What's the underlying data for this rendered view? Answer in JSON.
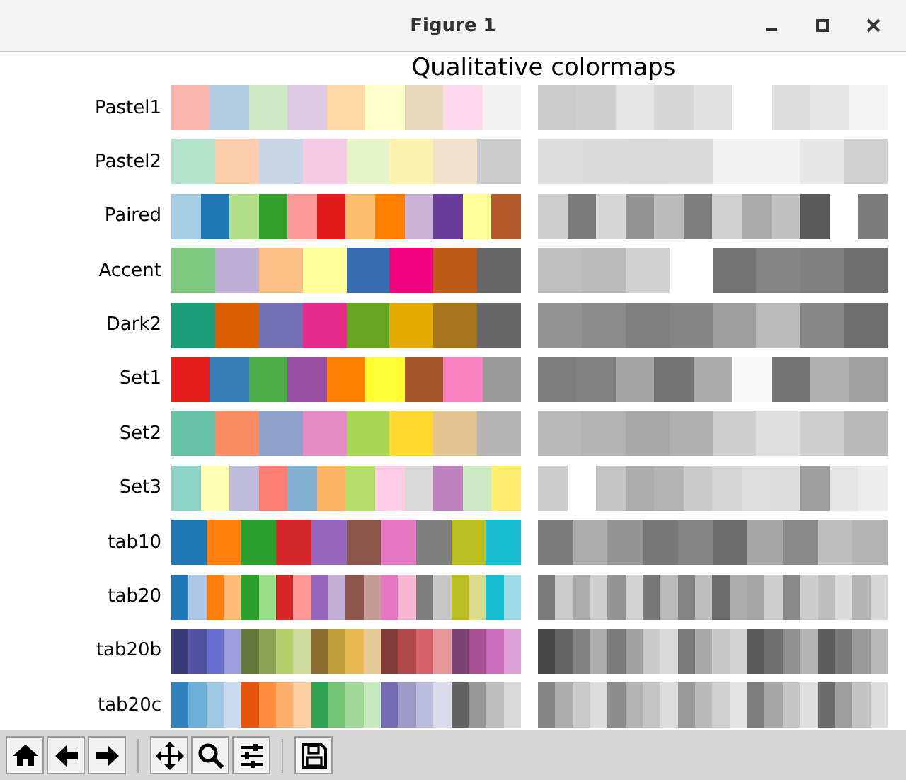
{
  "window": {
    "title": "Figure 1"
  },
  "figure": {
    "title": "Qualitative colormaps"
  },
  "colormaps": [
    {
      "name": "Pastel1",
      "colors": [
        {
          "color": "#fbb4ae"
        },
        {
          "color": "#b3cde3"
        },
        {
          "color": "#ccebc5"
        },
        {
          "color": "#decbe4"
        },
        {
          "color": "#fed9a6"
        },
        {
          "color": "#ffffcc"
        },
        {
          "color": "#e5d8bd"
        },
        {
          "color": "#fddaec"
        },
        {
          "color": "#f2f2f2"
        }
      ]
    },
    {
      "name": "Pastel2",
      "colors": [
        {
          "color": "#b3e2cd"
        },
        {
          "color": "#fdcdac"
        },
        {
          "color": "#cbd5e8"
        },
        {
          "color": "#f4cae4"
        },
        {
          "color": "#e6f5c9"
        },
        {
          "color": "#fff2ae"
        },
        {
          "color": "#f1e2cc"
        },
        {
          "color": "#cccccc"
        }
      ]
    },
    {
      "name": "Paired",
      "colors": [
        {
          "color": "#a6cee3"
        },
        {
          "color": "#1f78b4"
        },
        {
          "color": "#b2df8a"
        },
        {
          "color": "#33a02c"
        },
        {
          "color": "#fb9a99"
        },
        {
          "color": "#e31a1c"
        },
        {
          "color": "#fdbf6f"
        },
        {
          "color": "#ff7f00"
        },
        {
          "color": "#cab2d6"
        },
        {
          "color": "#6a3d9a"
        },
        {
          "color": "#ffff99"
        },
        {
          "color": "#b15928"
        }
      ]
    },
    {
      "name": "Accent",
      "colors": [
        {
          "color": "#7fc97f"
        },
        {
          "color": "#beaed4"
        },
        {
          "color": "#fdc086"
        },
        {
          "color": "#ffff99"
        },
        {
          "color": "#386cb0"
        },
        {
          "color": "#f0027f"
        },
        {
          "color": "#bf5b17"
        },
        {
          "color": "#666666"
        }
      ]
    },
    {
      "name": "Dark2",
      "colors": [
        {
          "color": "#1b9e77"
        },
        {
          "color": "#d95f02"
        },
        {
          "color": "#7570b3"
        },
        {
          "color": "#e7298a"
        },
        {
          "color": "#66a61e"
        },
        {
          "color": "#e6ab02"
        },
        {
          "color": "#a6761d"
        },
        {
          "color": "#666666"
        }
      ]
    },
    {
      "name": "Set1",
      "colors": [
        {
          "color": "#e41a1c"
        },
        {
          "color": "#377eb8"
        },
        {
          "color": "#4daf4a"
        },
        {
          "color": "#984ea3"
        },
        {
          "color": "#ff7f00"
        },
        {
          "color": "#ffff33"
        },
        {
          "color": "#a65628"
        },
        {
          "color": "#f781bf"
        },
        {
          "color": "#999999"
        }
      ]
    },
    {
      "name": "Set2",
      "colors": [
        {
          "color": "#66c2a5"
        },
        {
          "color": "#fc8d62"
        },
        {
          "color": "#8da0cb"
        },
        {
          "color": "#e78ac3"
        },
        {
          "color": "#a6d854"
        },
        {
          "color": "#ffd92f"
        },
        {
          "color": "#e5c494"
        },
        {
          "color": "#b3b3b3"
        }
      ]
    },
    {
      "name": "Set3",
      "colors": [
        {
          "color": "#8dd3c7"
        },
        {
          "color": "#ffffb3"
        },
        {
          "color": "#bebada"
        },
        {
          "color": "#fb8072"
        },
        {
          "color": "#80b1d3"
        },
        {
          "color": "#fdb462"
        },
        {
          "color": "#b3de69"
        },
        {
          "color": "#fccde5"
        },
        {
          "color": "#d9d9d9"
        },
        {
          "color": "#bc80bd"
        },
        {
          "color": "#ccebc5"
        },
        {
          "color": "#ffed6f"
        }
      ]
    },
    {
      "name": "tab10",
      "colors": [
        {
          "color": "#1f77b4"
        },
        {
          "color": "#ff7f0e"
        },
        {
          "color": "#2ca02c"
        },
        {
          "color": "#d62728"
        },
        {
          "color": "#9467bd"
        },
        {
          "color": "#8c564b"
        },
        {
          "color": "#e377c2"
        },
        {
          "color": "#7f7f7f"
        },
        {
          "color": "#bcbd22"
        },
        {
          "color": "#17becf"
        }
      ]
    },
    {
      "name": "tab20",
      "colors": [
        {
          "color": "#1f77b4"
        },
        {
          "color": "#aec7e8"
        },
        {
          "color": "#ff7f0e"
        },
        {
          "color": "#ffbb78"
        },
        {
          "color": "#2ca02c"
        },
        {
          "color": "#98df8a"
        },
        {
          "color": "#d62728"
        },
        {
          "color": "#ff9896"
        },
        {
          "color": "#9467bd"
        },
        {
          "color": "#c5b0d5"
        },
        {
          "color": "#8c564b"
        },
        {
          "color": "#c49c94"
        },
        {
          "color": "#e377c2"
        },
        {
          "color": "#f7b6d2"
        },
        {
          "color": "#7f7f7f"
        },
        {
          "color": "#c7c7c7"
        },
        {
          "color": "#bcbd22"
        },
        {
          "color": "#dbdb8d"
        },
        {
          "color": "#17becf"
        },
        {
          "color": "#9edae5"
        }
      ]
    },
    {
      "name": "tab20b",
      "colors": [
        {
          "color": "#393b79"
        },
        {
          "color": "#5254a3"
        },
        {
          "color": "#6b6ecf"
        },
        {
          "color": "#9c9ede"
        },
        {
          "color": "#637939"
        },
        {
          "color": "#8ca252"
        },
        {
          "color": "#b5cf6b"
        },
        {
          "color": "#cedb9c"
        },
        {
          "color": "#8c6d31"
        },
        {
          "color": "#bd9e39"
        },
        {
          "color": "#e7ba52"
        },
        {
          "color": "#e7cb94"
        },
        {
          "color": "#843c39"
        },
        {
          "color": "#ad494a"
        },
        {
          "color": "#d6616b"
        },
        {
          "color": "#e7969c"
        },
        {
          "color": "#7b4173"
        },
        {
          "color": "#a55194"
        },
        {
          "color": "#ce6dbd"
        },
        {
          "color": "#de9ed6"
        }
      ]
    },
    {
      "name": "tab20c",
      "colors": [
        {
          "color": "#3182bd"
        },
        {
          "color": "#6baed6"
        },
        {
          "color": "#9ecae1"
        },
        {
          "color": "#c6dbef"
        },
        {
          "color": "#e6550d"
        },
        {
          "color": "#fd8d3c"
        },
        {
          "color": "#fdae6b"
        },
        {
          "color": "#fdd0a2"
        },
        {
          "color": "#31a354"
        },
        {
          "color": "#74c476"
        },
        {
          "color": "#a1d99b"
        },
        {
          "color": "#c7e9c0"
        },
        {
          "color": "#756bb1"
        },
        {
          "color": "#9e9ac8"
        },
        {
          "color": "#bcbddc"
        },
        {
          "color": "#dadaeb"
        },
        {
          "color": "#636363"
        },
        {
          "color": "#969696"
        },
        {
          "color": "#bdbdbd"
        },
        {
          "color": "#d9d9d9"
        }
      ]
    }
  ]
}
